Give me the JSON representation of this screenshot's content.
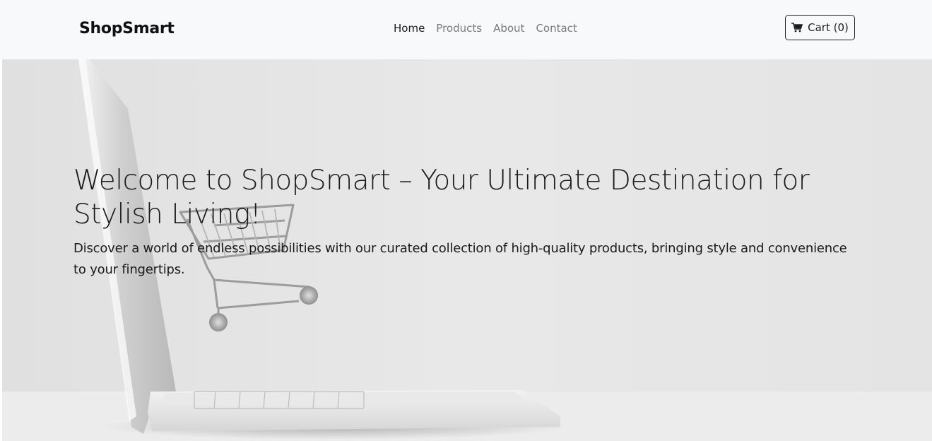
{
  "navbar": {
    "brand": "ShopSmart",
    "links": [
      {
        "label": "Home",
        "active": true
      },
      {
        "label": "Products",
        "active": false
      },
      {
        "label": "About",
        "active": false
      },
      {
        "label": "Contact",
        "active": false
      }
    ],
    "cart": {
      "icon": "shopping-cart-icon",
      "label": "Cart (0)"
    }
  },
  "hero": {
    "title": "Welcome to ShopSmart – Your Ultimate Destination for Stylish Living!",
    "subtitle": "Discover a world of endless possibilities with our curated collection of high-quality products, bringing style and convenience to your fingertips.",
    "background_image": "laptop-with-shopping-cart"
  },
  "colors": {
    "navbar_bg": "#f8f9fa",
    "text_dark": "#1a1a1a",
    "nav_muted": "#7a7a7a",
    "hero_bg": "#e6e6e6"
  }
}
